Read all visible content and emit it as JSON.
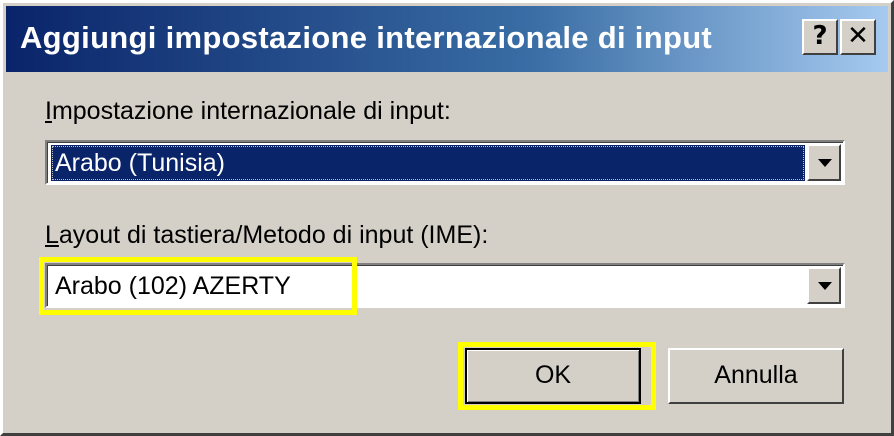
{
  "window": {
    "title": "Aggiungi impostazione internazionale di input",
    "help_label": "?",
    "close_label": "✕"
  },
  "locale": {
    "label_mnemonic": "I",
    "label_rest": "mpostazione internazionale di input:",
    "value": "Arabo (Tunisia)"
  },
  "keyboard": {
    "label_mnemonic": "L",
    "label_rest": "ayout di tastiera/Metodo di input (IME):",
    "value": "Arabo (102) AZERTY"
  },
  "buttons": {
    "ok_label": "OK",
    "cancel_label": "Annulla"
  },
  "colors": {
    "title_bar": "#0a246a",
    "dialog_face": "#d4d0c8",
    "selection": "#0a246a",
    "highlight": "#ffff00"
  },
  "icons": {
    "dropdown": "chevron-down-icon",
    "help": "help-icon",
    "close": "close-icon"
  }
}
